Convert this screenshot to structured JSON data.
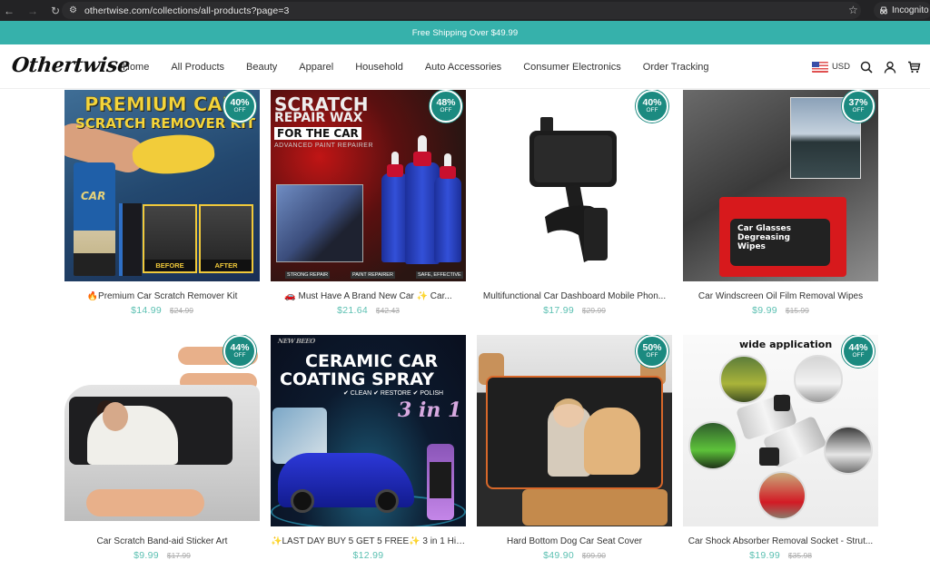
{
  "browser": {
    "url": "othertwise.com/collections/all-products?page=3",
    "mode_label": "Incognito",
    "icons": [
      "back-arrow-icon",
      "forward-arrow-icon",
      "reload-icon",
      "site-settings-icon",
      "bookmark-star-icon",
      "incognito-icon"
    ]
  },
  "announcement": {
    "text": "Free Shipping Over $49.99"
  },
  "header": {
    "logo": "Othertwise",
    "nav": [
      {
        "label": "Home"
      },
      {
        "label": "All Products"
      },
      {
        "label": "Beauty"
      },
      {
        "label": "Apparel"
      },
      {
        "label": "Household"
      },
      {
        "label": "Auto Accessories"
      },
      {
        "label": "Consumer Electronics"
      },
      {
        "label": "Order Tracking"
      }
    ],
    "currency": "USD",
    "icons": [
      "us-flag-icon",
      "search-icon",
      "account-icon",
      "cart-icon"
    ]
  },
  "products": [
    {
      "title": "🔥Premium Car Scratch Remover Kit",
      "price": "$14.99",
      "compare_price": "$24.99",
      "discount": "40%",
      "discount_suffix": "OFF",
      "image_text": {
        "line1": "PREMIUM CAR",
        "line2": "SCRATCH REMOVER KIT",
        "tube": "CAR",
        "before": "BEFORE",
        "after": "AFTER"
      }
    },
    {
      "title": "🚗 Must Have A Brand New Car ✨ Car...",
      "price": "$21.64",
      "compare_price": "$42.43",
      "discount": "48%",
      "discount_suffix": "OFF",
      "image_text": {
        "line1": "SCRATCH",
        "line2": "REPAIR WAX",
        "line3": "FOR THE CAR",
        "line4": "ADVANCED PAINT REPAIRER",
        "tag1": "STRONG REPAIR",
        "tag2": "PAINT REPAIRER",
        "tag3": "SAFE, EFFECTIVE"
      }
    },
    {
      "title": "Multifunctional Car Dashboard Mobile Phon...",
      "price": "$17.99",
      "compare_price": "$29.99",
      "discount": "40%",
      "discount_suffix": "OFF"
    },
    {
      "title": "Car Windscreen Oil Film Removal Wipes",
      "price": "$9.99",
      "compare_price": "$15.99",
      "discount": "37%",
      "discount_suffix": "OFF",
      "image_text": {
        "pack": "Car Glasses\nDegreasing\nWipes"
      }
    },
    {
      "title": "Car Scratch Band-aid Sticker Art",
      "price": "$9.99",
      "compare_price": "$17.99",
      "discount": "44%",
      "discount_suffix": "OFF"
    },
    {
      "title": "✨LAST DAY BUY 5 GET 5 FREE✨ 3 in 1 Hig...",
      "price": "$12.99",
      "compare_price": "",
      "discount": "",
      "discount_suffix": "",
      "image_text": {
        "brand": "NEW BEEO",
        "line1": "CERAMIC CAR",
        "line2": "COATING SPRAY",
        "checks": "✔ CLEAN   ✔ RESTORE   ✔ POLISH",
        "big": "3 in 1"
      }
    },
    {
      "title": "Hard Bottom Dog Car Seat Cover",
      "price": "$49.90",
      "compare_price": "$99.90",
      "discount": "50%",
      "discount_suffix": "OFF"
    },
    {
      "title": "Car Shock Absorber Removal Socket - Strut...",
      "price": "$19.99",
      "compare_price": "$35.98",
      "discount": "44%",
      "discount_suffix": "OFF",
      "image_text": {
        "heading": "wide application"
      }
    }
  ],
  "colors": {
    "accent": "#36b1ab",
    "badge": "#1b8a80",
    "price": "#5cc0b2",
    "compare_price": "#aaaaaa"
  }
}
